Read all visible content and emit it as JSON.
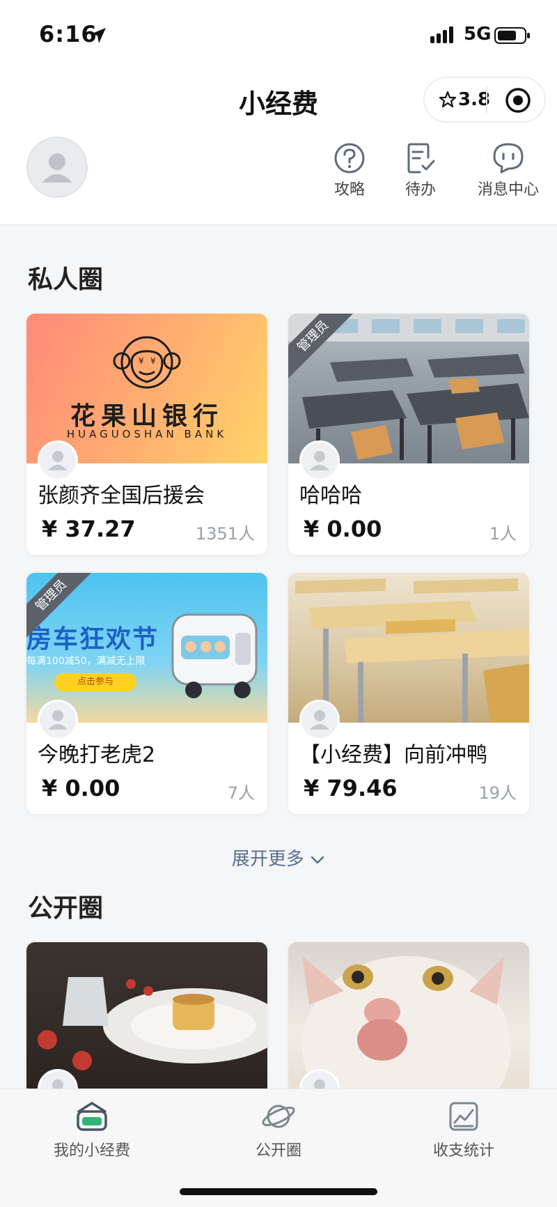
{
  "status": {
    "time": "6:16",
    "network": "5G"
  },
  "nav": {
    "title": "小经费",
    "rating": "3.8"
  },
  "header": {
    "actions": [
      {
        "label": "攻略",
        "icon": "question-circle-icon"
      },
      {
        "label": "待办",
        "icon": "todo-list-icon"
      },
      {
        "label": "消息中心",
        "icon": "message-bubble-icon"
      }
    ]
  },
  "private": {
    "title": "私人圈",
    "cards": [
      {
        "name": "张颜齐全国后援会",
        "amount": "¥ 37.27",
        "members": "1351人",
        "admin": false,
        "image_text": "花果山银行",
        "image_subtext": "HUAGUOSHAN BANK"
      },
      {
        "name": "哈哈哈",
        "amount": "¥ 0.00",
        "members": "1人",
        "admin": true,
        "admin_label": "管理员"
      },
      {
        "name": "今晚打老虎2",
        "amount": "¥ 0.00",
        "members": "7人",
        "admin": true,
        "admin_label": "管理员",
        "image_text": "房车狂欢节",
        "image_subtext": "每满100减50，满减无上限",
        "image_button": "点击参与"
      },
      {
        "name": "【小经费】向前冲鸭",
        "amount": "¥ 79.46",
        "members": "19人",
        "admin": false
      }
    ],
    "more": "展开更多"
  },
  "public": {
    "title": "公开圈"
  },
  "tabs": [
    {
      "label": "我的小经费",
      "icon": "wallet-icon",
      "active": true
    },
    {
      "label": "公开圈",
      "icon": "planet-icon",
      "active": false
    },
    {
      "label": "收支统计",
      "icon": "chart-icon",
      "active": false
    }
  ],
  "colors": {
    "accent": "#2bb673",
    "bank_gradient_start": "#ff8a7a",
    "bank_gradient_end": "#ffd36a"
  }
}
